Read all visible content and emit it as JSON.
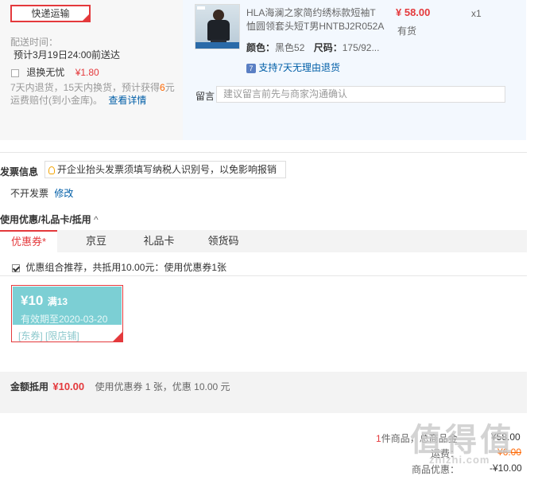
{
  "shipping": {
    "method_button": "快递运输",
    "time_label": "配送时间：",
    "time_value": "预计3月19日24:00前送达",
    "return_label": "退换无忧",
    "return_price": "¥1.80",
    "return_desc_1a": "7天内退货，15天内换货，预计获得",
    "return_desc_num": "6",
    "return_desc_1b": "元",
    "return_desc_2": "运费赔付(到小金库)。",
    "details_link": "查看详情"
  },
  "product": {
    "title_line1": "HLA海澜之家简约绣标款短袖T",
    "title_line2": "恤圆领套头短T男HNTBJ2R052A",
    "price": "¥ 58.00",
    "quantity": "x1",
    "stock": "有货",
    "color_label": "颜色：",
    "color_value": "黑色52",
    "size_label": "尺码：",
    "size_value": "175/92...",
    "return_policy": "支持7天无理由退货",
    "message_label": "留言：",
    "message_placeholder": "建议留言前先与商家沟通确认"
  },
  "invoice": {
    "title": "发票信息",
    "tip": "开企业抬头发票须填写纳税人识别号，以免影响报销",
    "status": "不开发票",
    "modify_link": "修改"
  },
  "coupons": {
    "section_title": "使用优惠/礼品卡/抵用",
    "tabs": [
      {
        "label": "优惠券*"
      },
      {
        "label": "京豆"
      },
      {
        "label": "礼品卡"
      },
      {
        "label": "领货码"
      }
    ],
    "recommend_text": "优惠组合推荐，共抵用10.00元：使用优惠券1张",
    "card": {
      "amount": "¥10",
      "condition": "满13",
      "validity": "有效期至2020-03-20",
      "tags": "[东券] [限店铺]"
    }
  },
  "total": {
    "label": "金额抵用",
    "amount": "¥10.00",
    "desc": "使用优惠券 1 张，优惠 10.00 元"
  },
  "summary": {
    "count": "1",
    "count_suffix": "件商品，总商品金",
    "goods_amount": "¥58.00",
    "shipping_label": "运费：",
    "shipping_amount": "¥6.00",
    "discount_label": "商品优惠：",
    "discount_amount": "-¥10.00"
  },
  "watermark": {
    "text": "值得值",
    "url": "zhizhi.com"
  }
}
